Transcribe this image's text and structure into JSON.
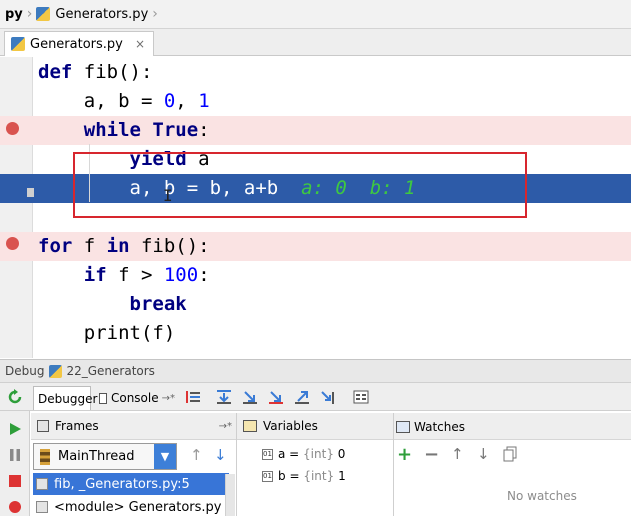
{
  "breadcrumb": {
    "root": "py",
    "file": "Generators.py"
  },
  "editor_tab": {
    "label": "Generators.py",
    "close": "×"
  },
  "code_lines": [
    {
      "parts": [
        {
          "t": "def",
          "c": "kw"
        },
        {
          "t": " fib():",
          "c": ""
        }
      ]
    },
    {
      "parts": [
        {
          "t": "    a, b = ",
          "c": ""
        },
        {
          "t": "0",
          "c": "num"
        },
        {
          "t": ", ",
          "c": ""
        },
        {
          "t": "1",
          "c": "num"
        }
      ]
    },
    {
      "parts": [
        {
          "t": "    ",
          "c": ""
        },
        {
          "t": "while True",
          "c": "kw"
        },
        {
          "t": ":",
          "c": ""
        }
      ]
    },
    {
      "parts": [
        {
          "t": "        ",
          "c": ""
        },
        {
          "t": "yield",
          "c": "kw"
        },
        {
          "t": " a",
          "c": ""
        }
      ]
    },
    {
      "parts": [
        {
          "t": "        a, b = b, a+b",
          "c": ""
        },
        {
          "t": "  a: 0  b: 1",
          "c": "inline"
        }
      ]
    },
    {
      "parts": [
        {
          "t": "",
          "c": ""
        }
      ]
    },
    {
      "parts": [
        {
          "t": "for",
          "c": "kw"
        },
        {
          "t": " f ",
          "c": ""
        },
        {
          "t": "in",
          "c": "kw"
        },
        {
          "t": " fib():",
          "c": ""
        }
      ]
    },
    {
      "parts": [
        {
          "t": "    ",
          "c": ""
        },
        {
          "t": "if",
          "c": "kw"
        },
        {
          "t": " f > ",
          "c": ""
        },
        {
          "t": "100",
          "c": "num"
        },
        {
          "t": ":",
          "c": ""
        }
      ]
    },
    {
      "parts": [
        {
          "t": "        ",
          "c": ""
        },
        {
          "t": "break",
          "c": "kw"
        }
      ]
    },
    {
      "parts": [
        {
          "t": "    print(f)",
          "c": ""
        }
      ]
    }
  ],
  "debug": {
    "title": "Debug",
    "config": "22_Generators",
    "tabs": {
      "debugger": "Debugger",
      "console": "Console"
    },
    "frames_header": "Frames",
    "variables_header": "Variables",
    "watches_header": "Watches",
    "thread": "MainThread",
    "frames": [
      {
        "label": "fib, _Generators.py:5",
        "selected": true
      },
      {
        "label": "<module> Generators.py",
        "selected": false
      }
    ],
    "variables": [
      {
        "name": "a",
        "type": "{int}",
        "value": "0"
      },
      {
        "name": "b",
        "type": "{int}",
        "value": "1"
      }
    ],
    "no_watches": "No watches"
  },
  "colors": {
    "breakpoint_line": "#fae3e3",
    "execution_line": "#2d5ba8",
    "inline_values": "#3ec940",
    "annotation_box": "#d7262e"
  }
}
